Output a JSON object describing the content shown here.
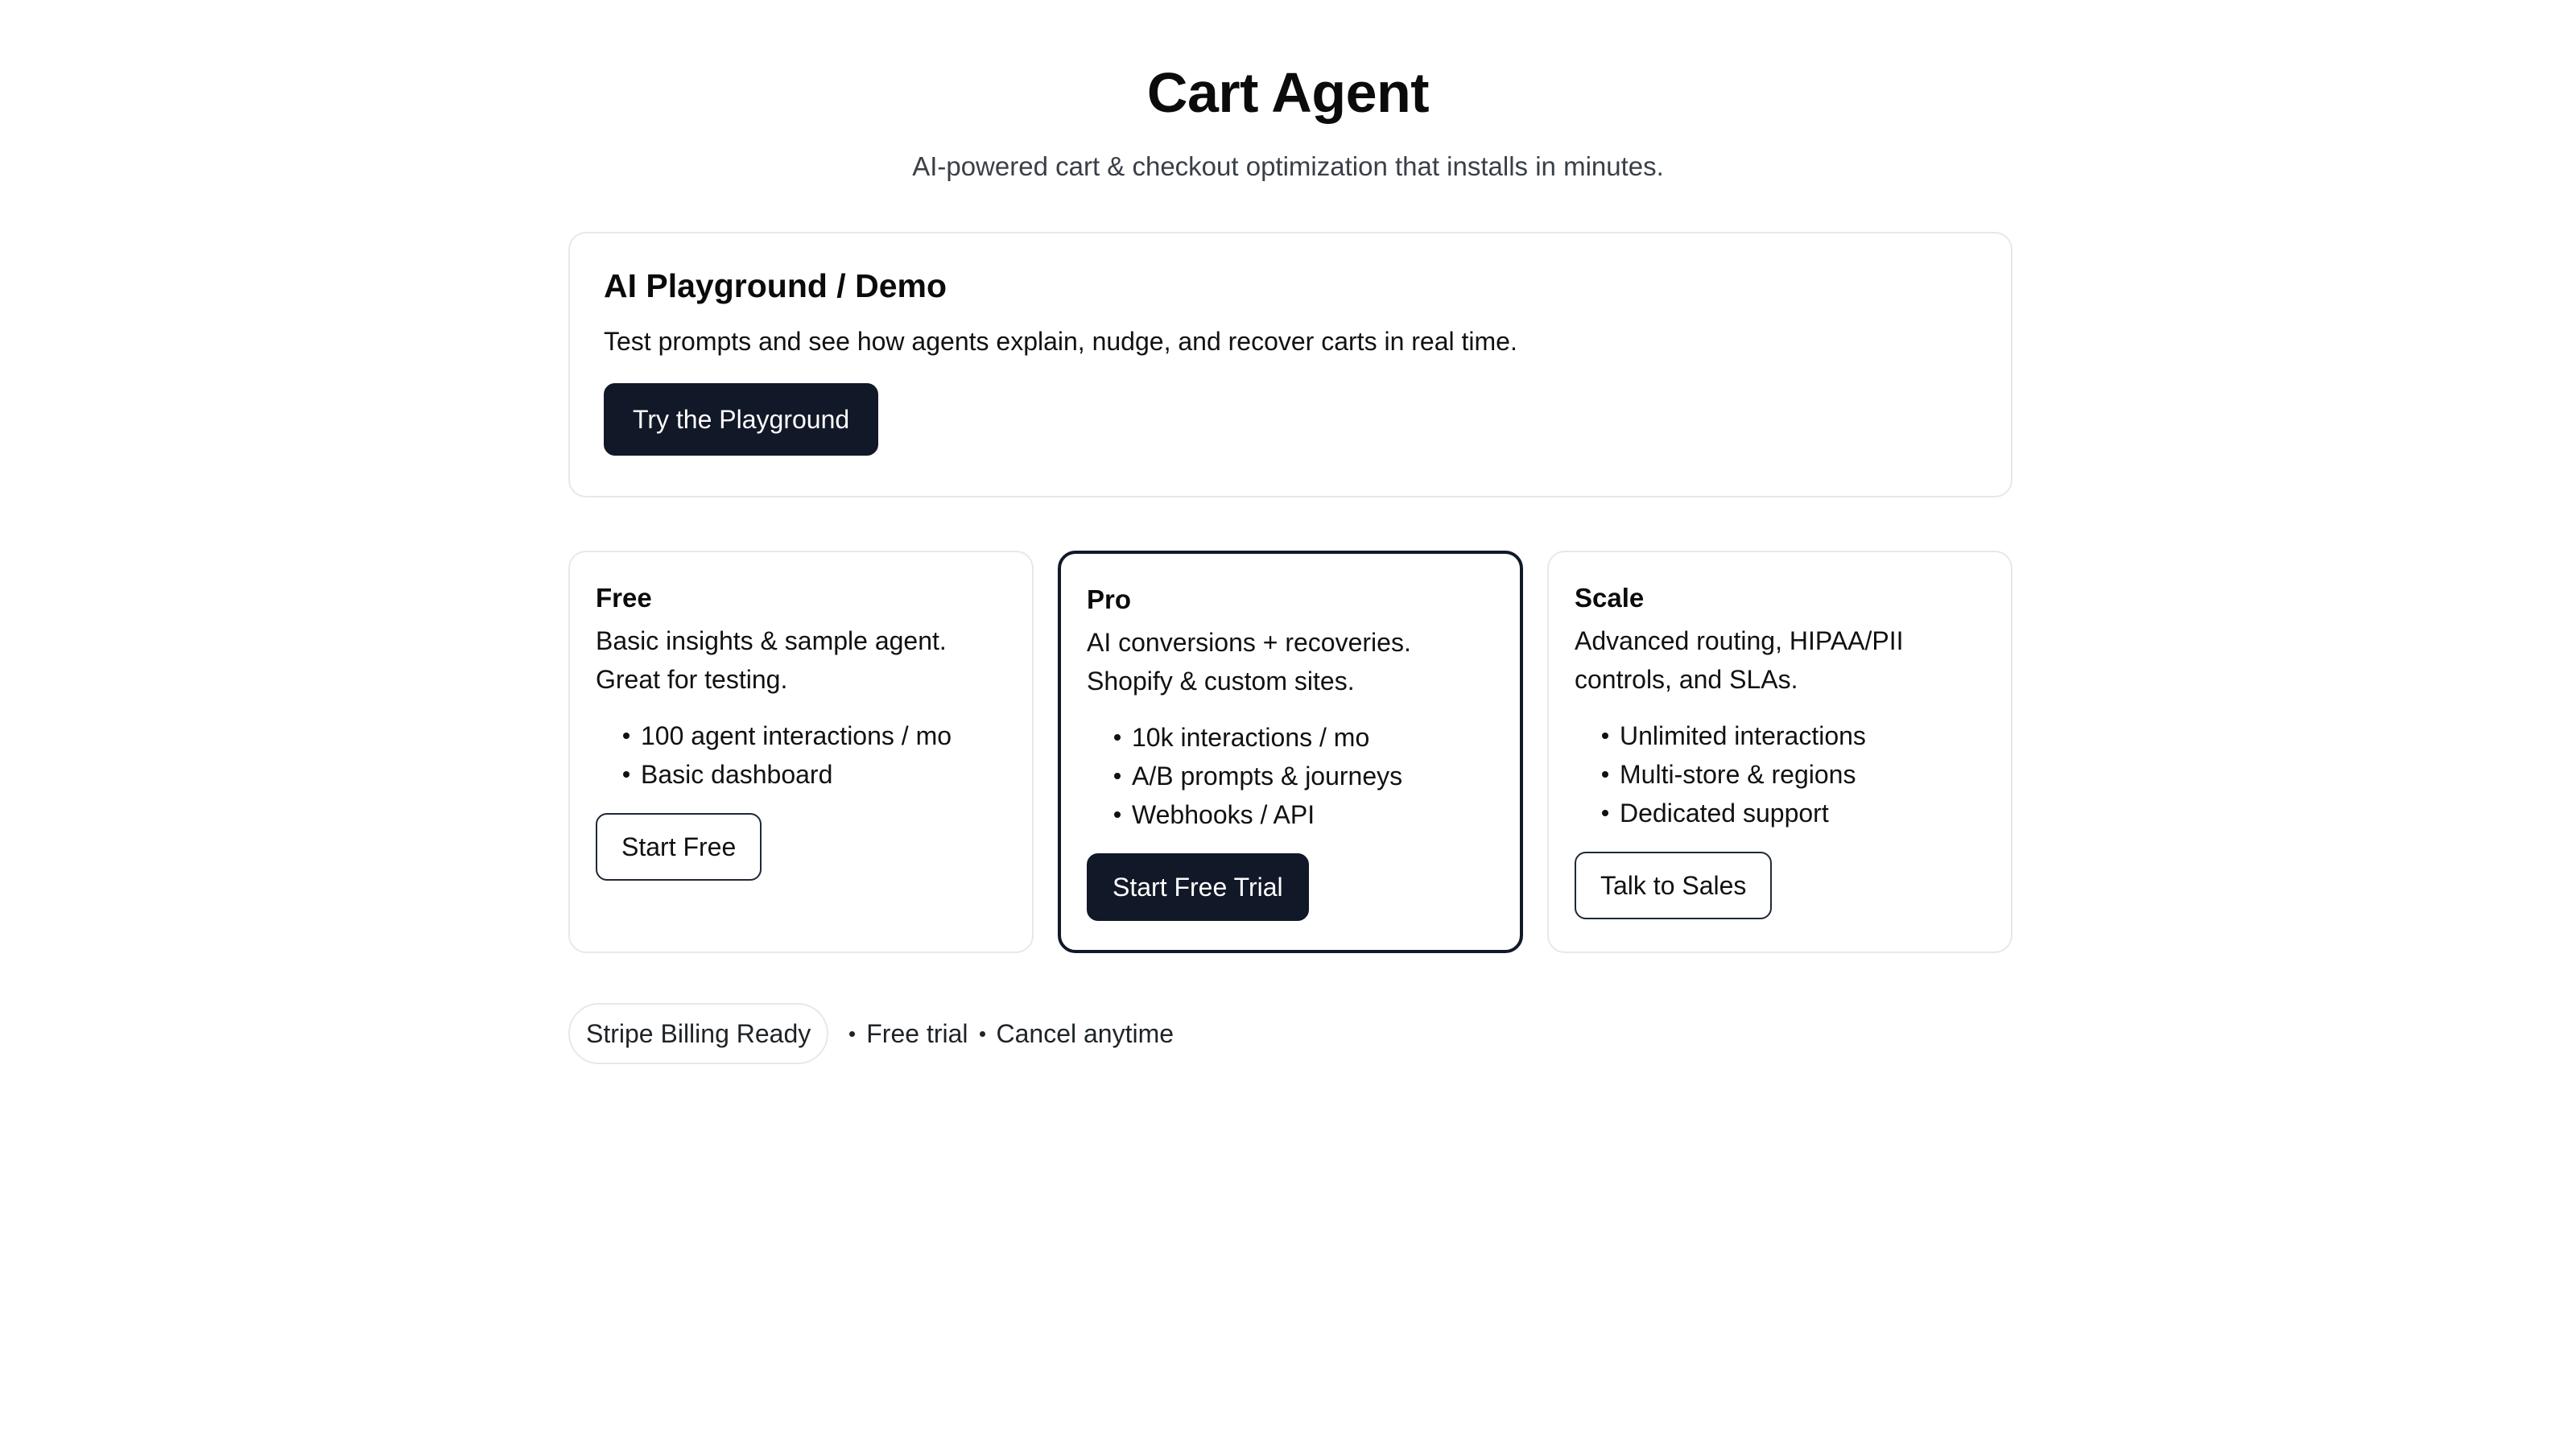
{
  "header": {
    "title": "Cart Agent",
    "subtitle": "AI-powered cart & checkout optimization that installs in minutes."
  },
  "demo": {
    "title": "AI Playground / Demo",
    "description": "Test prompts and see how agents explain, nudge, and recover carts in real time.",
    "button_label": "Try the Playground"
  },
  "plans": [
    {
      "name": "Free",
      "description": "Basic insights & sample agent. Great for testing.",
      "features": [
        "100 agent interactions / mo",
        "Basic dashboard"
      ],
      "button_label": "Start Free"
    },
    {
      "name": "Pro",
      "description": "AI conversions + recoveries. Shopify & custom sites.",
      "features": [
        "10k interactions / mo",
        "A/B prompts & journeys",
        "Webhooks / API"
      ],
      "button_label": "Start Free Trial"
    },
    {
      "name": "Scale",
      "description": "Advanced routing, HIPAA/PII controls, and SLAs.",
      "features": [
        "Unlimited interactions",
        "Multi-store & regions",
        "Dedicated support"
      ],
      "button_label": "Talk to Sales"
    }
  ],
  "footer": {
    "badge": "Stripe Billing Ready",
    "note_1": "Free trial",
    "note_2": "Cancel anytime"
  },
  "colors": {
    "primary_dark": "#111827",
    "border_light": "#e6e8ec",
    "background": "#ffffff"
  }
}
